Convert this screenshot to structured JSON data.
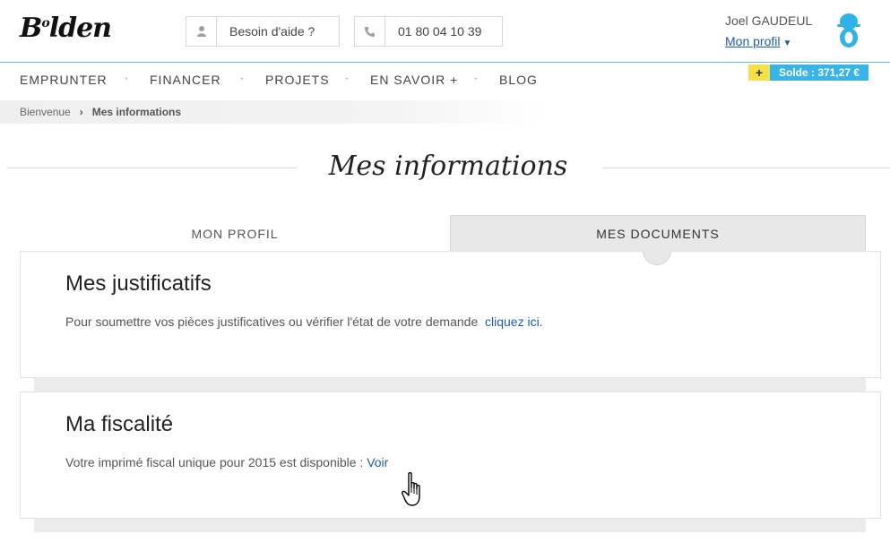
{
  "brand": {
    "logo_text": "Bolden",
    "logo_superscript": "o"
  },
  "header": {
    "help_label": "Besoin d'aide ?",
    "phone_number": "01 80 04 10 39",
    "user_name": "Joel GAUDEUL",
    "profile_link": "Mon profil",
    "balance_plus": "+",
    "balance_label": "Solde : 371,27 €"
  },
  "nav": {
    "items": [
      "EMPRUNTER",
      "FINANCER",
      "PROJETS",
      "EN SAVOIR +",
      "BLOG"
    ],
    "separator": "·"
  },
  "breadcrumb": {
    "home": "Bienvenue",
    "separator": "›",
    "current": "Mes informations"
  },
  "page": {
    "title": "Mes informations"
  },
  "tabs": {
    "profile": "MON PROFIL",
    "documents": "MES DOCUMENTS"
  },
  "justificatifs": {
    "heading": "Mes justificatifs",
    "text": "Pour soumettre vos pièces justificatives ou vérifier l'état de votre demande",
    "link": "cliquez ici",
    "suffix": "."
  },
  "fiscalite": {
    "heading": "Ma fiscalité",
    "text": "Votre imprimé fiscal unique pour 2015 est disponible :",
    "link": "Voir"
  },
  "icons": {
    "user": "user-icon",
    "phone": "phone-icon",
    "avatar": "avatar-icon",
    "cursor": "hand-cursor-icon"
  },
  "colors": {
    "link": "#1e5ea8",
    "accent_blue": "#39b4e6",
    "accent_yellow": "#f6e04a",
    "header_rule": "#5bc0de"
  }
}
